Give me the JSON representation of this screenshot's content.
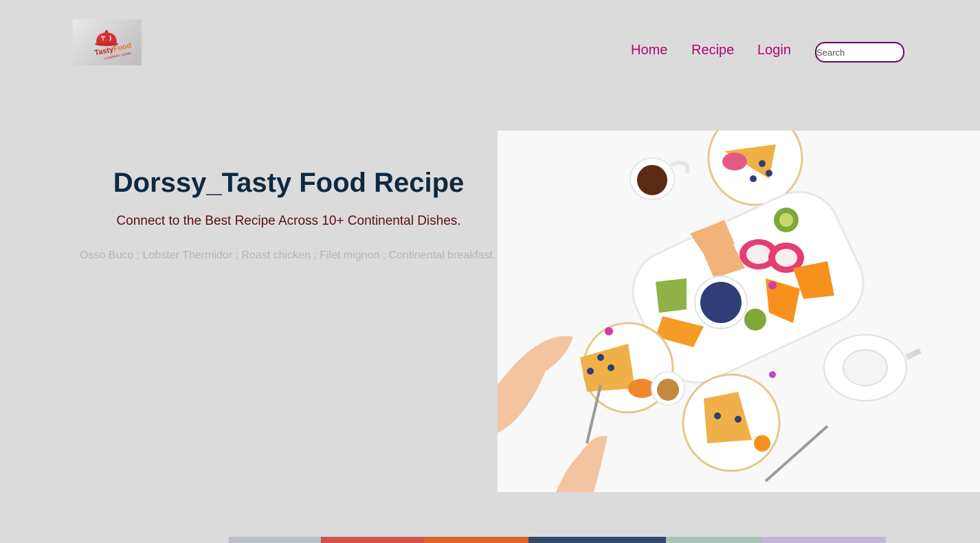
{
  "logo": {
    "brand_first": "Tasty",
    "brand_second": "Food",
    "tagline": "COMPANY NAME",
    "icon": "cloche-icon"
  },
  "nav": {
    "items": [
      {
        "label": "Home"
      },
      {
        "label": "Recipe"
      },
      {
        "label": "Login"
      }
    ],
    "search_placeholder": "Search"
  },
  "hero": {
    "title": "Dorssy_Tasty Food Recipe",
    "subtitle": "Connect to the Best Recipe Across 10+ Continental Dishes.",
    "dishes": "Osso Buco ; Lobster Thermidor ; Roast chicken ; Filet mignon ; Continental breakfast."
  },
  "colors": {
    "background": "#dcdbdc",
    "nav_link": "#b0066f",
    "title": "#0e2941",
    "subtitle": "#5a0f16",
    "search_border": "#5c0d5c"
  }
}
